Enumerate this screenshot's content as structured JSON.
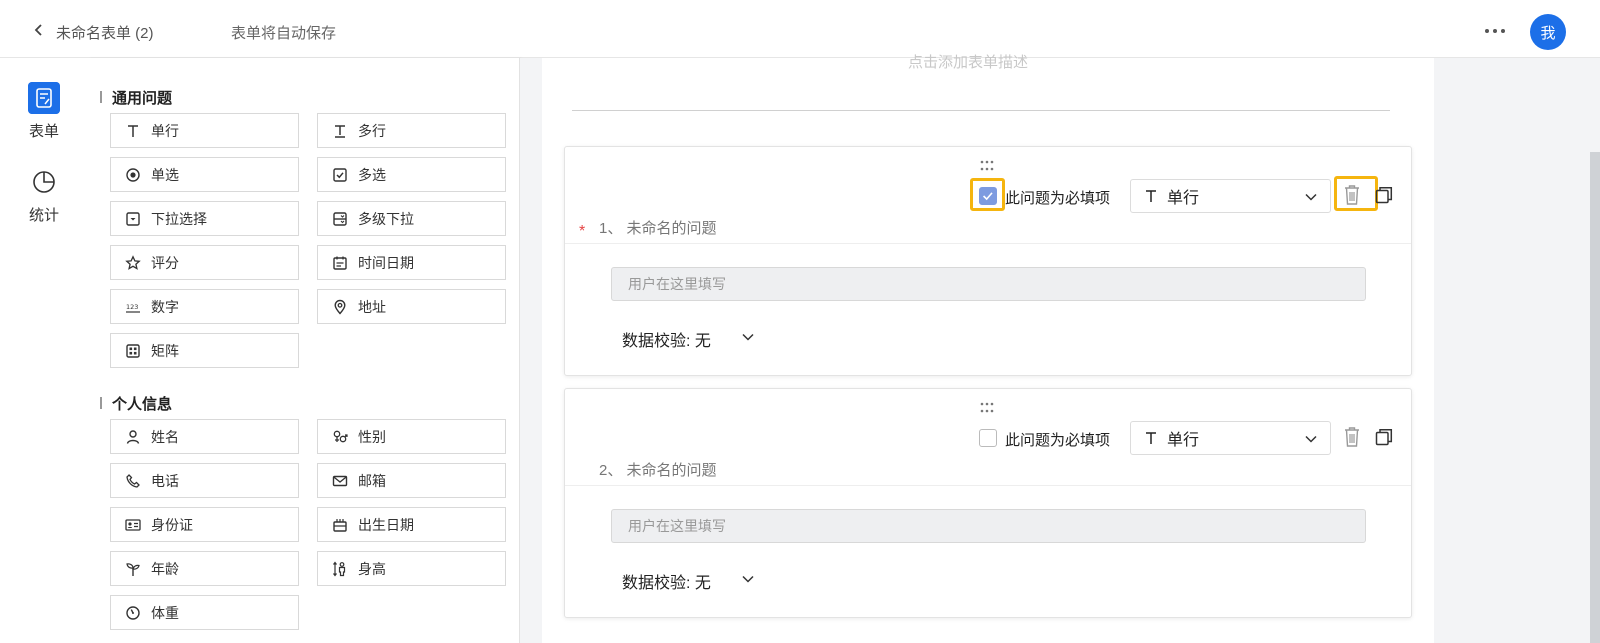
{
  "header": {
    "back_icon": "chevron-left-icon",
    "title": "未命名表单 (2)",
    "autosave": "表单将自动保存",
    "more_icon": "ellipsis-icon",
    "avatar": "我"
  },
  "rail": {
    "items": [
      {
        "label": "表单",
        "icon": "form-icon",
        "active": true
      },
      {
        "label": "统计",
        "icon": "pie-chart-icon",
        "active": false
      }
    ]
  },
  "palette": {
    "general_title": "通用问题",
    "general": [
      {
        "label": "单行",
        "icon": "text-icon"
      },
      {
        "label": "多行",
        "icon": "multiline-text-icon"
      },
      {
        "label": "单选",
        "icon": "radio-icon"
      },
      {
        "label": "多选",
        "icon": "checkbox-icon"
      },
      {
        "label": "下拉选择",
        "icon": "dropdown-icon"
      },
      {
        "label": "多级下拉",
        "icon": "cascade-dropdown-icon"
      },
      {
        "label": "评分",
        "icon": "star-icon"
      },
      {
        "label": "时间日期",
        "icon": "calendar-icon"
      },
      {
        "label": "数字",
        "icon": "number-icon"
      },
      {
        "label": "地址",
        "icon": "location-icon"
      },
      {
        "label": "矩阵",
        "icon": "matrix-icon"
      }
    ],
    "personal_title": "个人信息",
    "personal": [
      {
        "label": "姓名",
        "icon": "person-icon"
      },
      {
        "label": "性别",
        "icon": "gender-icon"
      },
      {
        "label": "电话",
        "icon": "phone-icon"
      },
      {
        "label": "邮箱",
        "icon": "mail-icon"
      },
      {
        "label": "身份证",
        "icon": "id-card-icon"
      },
      {
        "label": "出生日期",
        "icon": "birthday-icon"
      },
      {
        "label": "年龄",
        "icon": "sprout-icon"
      },
      {
        "label": "身高",
        "icon": "height-icon"
      },
      {
        "label": "体重",
        "icon": "scale-icon"
      }
    ]
  },
  "canvas": {
    "description_placeholder": "点击添加表单描述",
    "questions": [
      {
        "required_label": "此问题为必填项",
        "required": true,
        "type_label": "单行",
        "title": "1、 未命名的问题",
        "placeholder": "用户在这里填写",
        "validation": "数据校验: 无"
      },
      {
        "required_label": "此问题为必填项",
        "required": false,
        "type_label": "单行",
        "title": "2、 未命名的问题",
        "placeholder": "用户在这里填写",
        "validation": "数据校验: 无"
      }
    ]
  },
  "colors": {
    "accent": "#1c6fe8",
    "highlight": "#f5b50f",
    "required_star": "#e54545",
    "checked": "#7d9be0"
  }
}
